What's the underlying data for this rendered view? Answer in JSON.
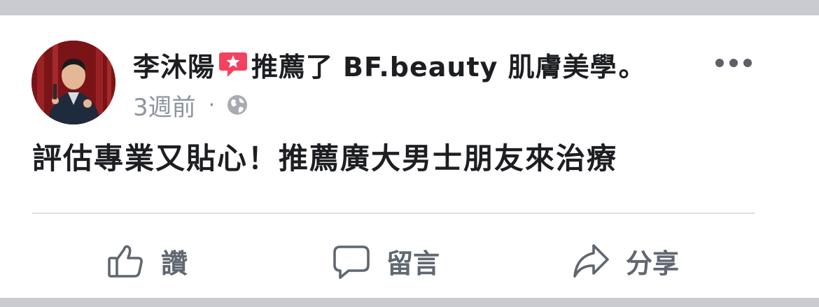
{
  "post": {
    "author": "李沐陽",
    "verb": "推薦了",
    "page_name": "BF.beauty 肌膚美學",
    "period": "。",
    "time": "3週前",
    "separator": "·",
    "privacy_icon": "globe-icon",
    "body": "評估專業又貼心！推薦廣大男士朋友來治療"
  },
  "actions": {
    "like_label": "讚",
    "comment_label": "留言",
    "share_label": "分享"
  },
  "colors": {
    "recommend_accent": "#f3425f",
    "text_primary": "#1c1e21",
    "text_secondary": "#8d949e",
    "action_gray": "#606770",
    "band_gray": "#cacbd0"
  }
}
